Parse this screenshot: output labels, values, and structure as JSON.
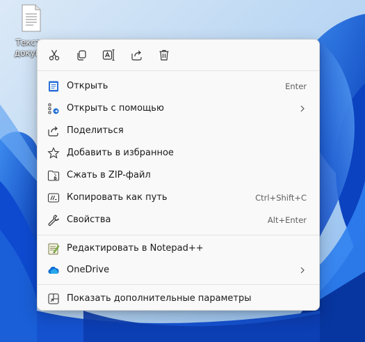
{
  "desktop": {
    "file_label_line1": "Тексто",
    "file_label_line2": "докуме",
    "file_icon": "text-document-icon"
  },
  "quick_actions": [
    {
      "name": "cut",
      "icon": "scissors-icon"
    },
    {
      "name": "copy",
      "icon": "copy-icon"
    },
    {
      "name": "rename",
      "icon": "rename-icon"
    },
    {
      "name": "share",
      "icon": "share-icon"
    },
    {
      "name": "delete",
      "icon": "trash-icon"
    }
  ],
  "menu": {
    "open": {
      "label": "Открыть",
      "shortcut": "Enter",
      "icon": "notepad-icon"
    },
    "open_with": {
      "label": "Открыть с помощью",
      "icon": "open-with-icon",
      "has_submenu": true
    },
    "share": {
      "label": "Поделиться",
      "icon": "share-icon"
    },
    "favorites": {
      "label": "Добавить в избранное",
      "icon": "star-icon"
    },
    "zip": {
      "label": "Сжать в ZIP-файл",
      "icon": "zip-folder-icon"
    },
    "copy_path": {
      "label": "Копировать как путь",
      "shortcut": "Ctrl+Shift+C",
      "icon": "copy-path-icon"
    },
    "properties": {
      "label": "Свойства",
      "shortcut": "Alt+Enter",
      "icon": "wrench-icon"
    },
    "notepadpp": {
      "label": "Редактировать в Notepad++",
      "icon": "notepadpp-icon"
    },
    "onedrive": {
      "label": "OneDrive",
      "icon": "cloud-icon",
      "has_submenu": true
    },
    "more_options": {
      "label": "Показать дополнительные параметры",
      "icon": "more-options-icon"
    }
  },
  "colors": {
    "menu_bg": "#f9f9f9",
    "text": "#1a1a1a",
    "shortcut_text": "#5f5f5f",
    "accent_blue": "#0067c0",
    "wallpaper_blue": "#1a5fd8"
  }
}
